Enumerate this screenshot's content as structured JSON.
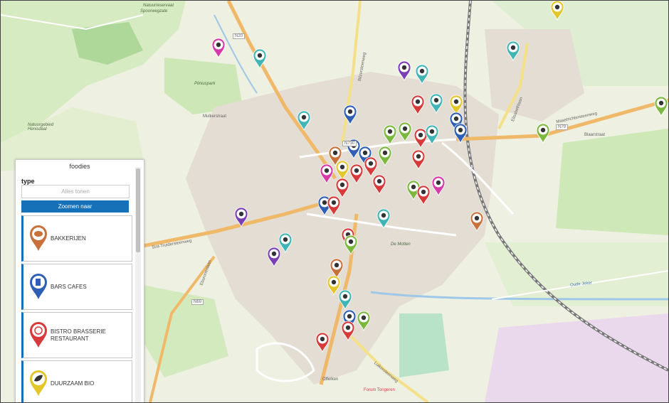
{
  "panel": {
    "title": "foodies",
    "filter_label": "type",
    "filter_placeholder": "Alles tonen",
    "zoom_button": "Zoomen naar",
    "categories": [
      {
        "label": "BAKKERIJEN",
        "color": "#c8713a",
        "icon": "bread-icon"
      },
      {
        "label": "BARS CAFES",
        "color": "#2f5fb5",
        "icon": "beer-icon"
      },
      {
        "label": "BISTRO BRASSERIE RESTAURANT",
        "color": "#d63a3a",
        "icon": "plate-icon"
      },
      {
        "label": "DUURZAAM BIO",
        "color": "#e3c62a",
        "icon": "leaf-icon"
      }
    ]
  },
  "map": {
    "labels": [
      {
        "text": "Natuurreservaat",
        "italic": true
      },
      {
        "text": "Spoorwegzate",
        "italic": true
      },
      {
        "text": "Pliniuspark",
        "italic": true
      },
      {
        "text": "Natuurgebied Henisdaal",
        "italic": true
      },
      {
        "text": "De Motten",
        "italic": true
      },
      {
        "text": "Sint-Truidersteenweg",
        "italic": false
      },
      {
        "text": "Maastrichtersteenweg",
        "italic": false
      },
      {
        "text": "Luikersteenweg",
        "italic": false
      },
      {
        "text": "Bilzersteenweg",
        "italic": false
      },
      {
        "text": "Elisabethlaan",
        "italic": false
      },
      {
        "text": "Eburonenlaan",
        "italic": false
      },
      {
        "text": "Mulkerstraat",
        "italic": false
      },
      {
        "text": "Blaarstraat",
        "italic": false
      },
      {
        "text": "N20",
        "italic": false
      },
      {
        "text": "N730",
        "italic": false
      },
      {
        "text": "N79",
        "italic": false
      },
      {
        "text": "N69",
        "italic": false
      },
      {
        "text": "Offelken",
        "italic": false
      },
      {
        "text": "Forum Tongeren",
        "italic": false
      },
      {
        "text": "Oude Jeker",
        "italic": false
      }
    ],
    "marker_colors": [
      "#c8713a",
      "#2f5fb5",
      "#d63a3a",
      "#e3c62a",
      "#3fb5b5",
      "#7ab83e",
      "#7a3fb5",
      "#d63aa8",
      "#2fa38a"
    ]
  }
}
